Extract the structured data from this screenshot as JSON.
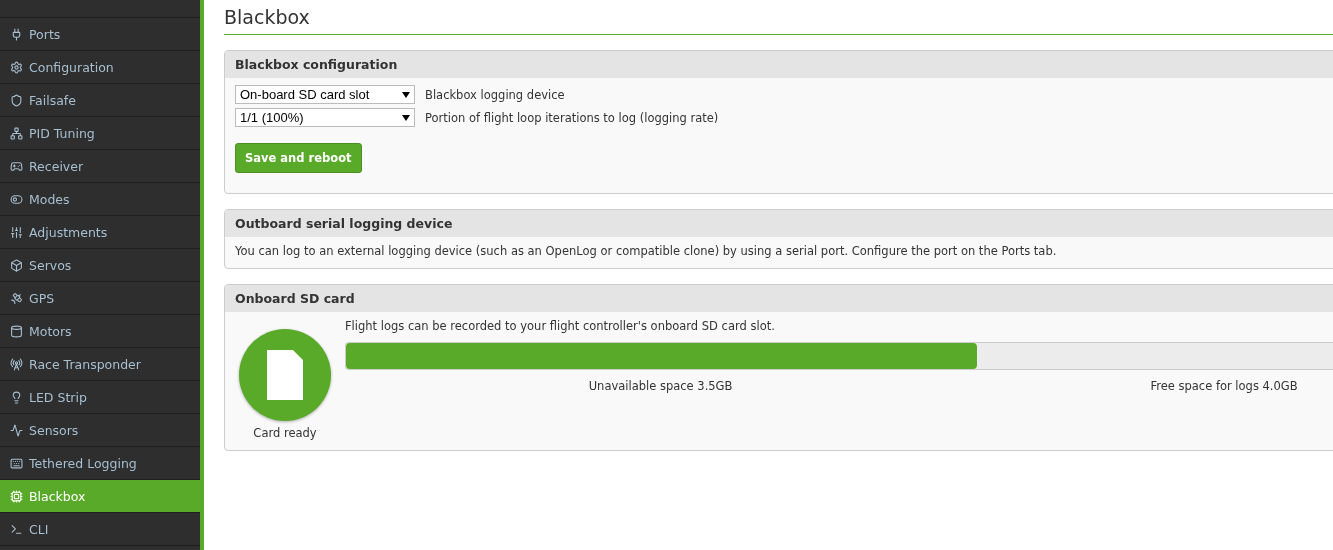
{
  "sidebar": {
    "items": [
      {
        "label": "Ports",
        "selected": false
      },
      {
        "label": "Configuration",
        "selected": false
      },
      {
        "label": "Failsafe",
        "selected": false
      },
      {
        "label": "PID Tuning",
        "selected": false
      },
      {
        "label": "Receiver",
        "selected": false
      },
      {
        "label": "Modes",
        "selected": false
      },
      {
        "label": "Adjustments",
        "selected": false
      },
      {
        "label": "Servos",
        "selected": false
      },
      {
        "label": "GPS",
        "selected": false
      },
      {
        "label": "Motors",
        "selected": false
      },
      {
        "label": "Race Transponder",
        "selected": false
      },
      {
        "label": "LED Strip",
        "selected": false
      },
      {
        "label": "Sensors",
        "selected": false
      },
      {
        "label": "Tethered Logging",
        "selected": false
      },
      {
        "label": "Blackbox",
        "selected": true
      },
      {
        "label": "CLI",
        "selected": false
      }
    ]
  },
  "page_title": "Blackbox",
  "config_panel": {
    "title": "Blackbox configuration",
    "settings": [
      {
        "value": "On-board SD card slot",
        "label": "Blackbox logging device"
      },
      {
        "value": "1/1 (100%)",
        "label": "Portion of flight loop iterations to log (logging rate)"
      }
    ],
    "button": "Save and reboot"
  },
  "serial_panel": {
    "title": "Outboard serial logging device",
    "text": "You can log to an external logging device (such as an OpenLog or compatible clone) by using a serial port. Configure the port on the Ports tab."
  },
  "sd_panel": {
    "title": "Onboard SD card",
    "status": "Card ready",
    "text": "Flight logs can be recorded to your flight controller's onboard SD card slot.",
    "usage": {
      "level": 0.56,
      "used_label": "Unavailable space 3.5GB",
      "free_label": "Free space for logs 4.0GB"
    }
  }
}
